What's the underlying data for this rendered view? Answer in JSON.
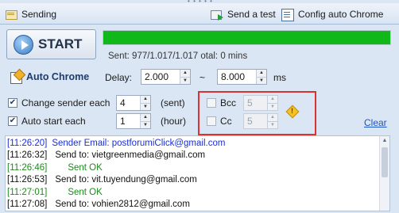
{
  "toolbar": {
    "sending_label": "Sending",
    "send_test_label": "Send a test",
    "config_chrome_label": "Config auto Chrome"
  },
  "start_button": {
    "label": "START"
  },
  "progress": {
    "fraction": 1.0,
    "color": "#10b81a"
  },
  "status": {
    "sent_text": "Sent: 977/1.017/1.017",
    "overlap_text": "otal: 0 mins"
  },
  "auto_chrome": {
    "label": "Auto Chrome",
    "delay_label": "Delay:",
    "delay_from": "2.000",
    "tilde": "~",
    "delay_to": "8.000",
    "unit": "ms"
  },
  "change_sender": {
    "checked": true,
    "label": "Change sender each",
    "value": "4",
    "unit": "(sent)"
  },
  "auto_start": {
    "checked": true,
    "label": "Auto start each",
    "value": "1",
    "unit": "(hour)"
  },
  "bcc": {
    "checked": false,
    "label": "Bcc",
    "value": "5"
  },
  "cc": {
    "checked": false,
    "label": "Cc",
    "value": "5"
  },
  "warning": {
    "glyph": "!"
  },
  "clear_label": "Clear",
  "log": [
    {
      "time": "[11:26:20]",
      "text": "Sender Email: postforumiClick@gmail.com",
      "color": "blue",
      "indent": 0
    },
    {
      "time": "[11:26:32]",
      "text": "Send to: vietgreenmedia@gmail.com",
      "color": "black",
      "indent": 1
    },
    {
      "time": "[11:26:46]",
      "text": "Sent OK",
      "color": "green",
      "indent": 2
    },
    {
      "time": "[11:26:53]",
      "text": "Send to: vit.tuyendung@gmail.com",
      "color": "black",
      "indent": 1
    },
    {
      "time": "[11:27:01]",
      "text": "Sent OK",
      "color": "green",
      "indent": 2
    },
    {
      "time": "[11:27:08]",
      "text": "Send to: vohien2812@gmail.com",
      "color": "black",
      "indent": 1
    }
  ]
}
